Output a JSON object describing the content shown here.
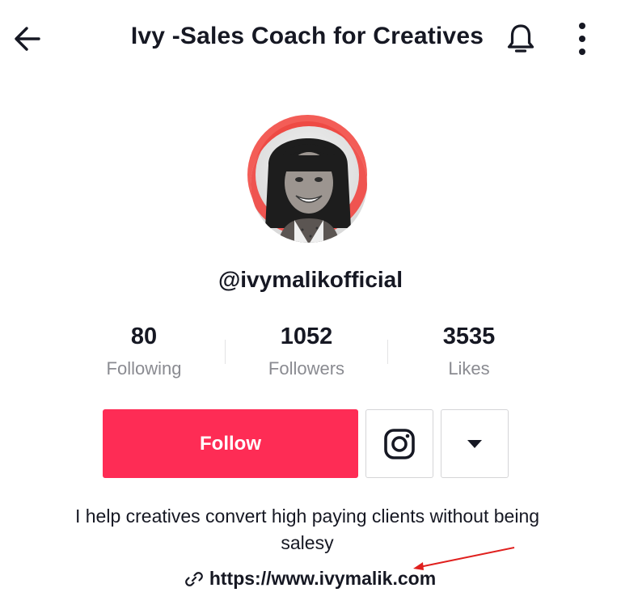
{
  "header": {
    "title": "Ivy -Sales Coach for Creatives",
    "back_icon": "arrow-left-icon",
    "bell_icon": "bell-icon",
    "more_icon": "more-vertical-icon"
  },
  "profile": {
    "handle": "@ivymalikofficial",
    "avatar_icon": "profile-photo"
  },
  "stats": {
    "following": {
      "value": "80",
      "label": "Following"
    },
    "followers": {
      "value": "1052",
      "label": "Followers"
    },
    "likes": {
      "value": "3535",
      "label": "Likes"
    }
  },
  "actions": {
    "follow_label": "Follow",
    "instagram_icon": "instagram-icon",
    "dropdown_icon": "caret-down-icon"
  },
  "bio": {
    "text": "I help creatives convert high paying clients without being salesy",
    "link_icon": "link-icon",
    "link": "https://www.ivymalik.com"
  },
  "colors": {
    "follow_bg": "#fe2c55",
    "label_gray": "#8a8b91",
    "annotation_red": "#e0201e"
  }
}
